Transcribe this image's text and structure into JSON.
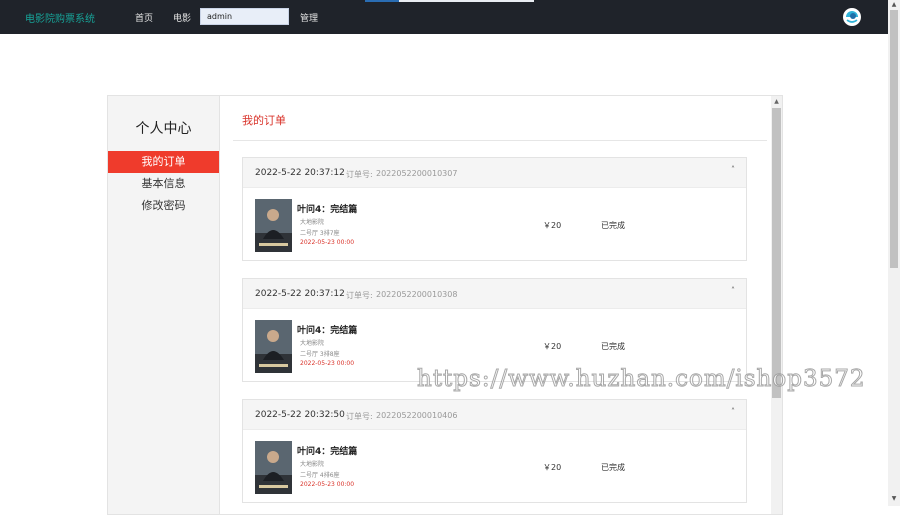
{
  "navbar": {
    "brand": "电影院购票系统",
    "links": [
      "首页",
      "电影"
    ],
    "search_value": "admin",
    "admin_link": "管理"
  },
  "sidebar": {
    "title": "个人中心",
    "items": [
      {
        "label": "我的订单",
        "active": true
      },
      {
        "label": "基本信息",
        "active": false
      },
      {
        "label": "修改密码",
        "active": false
      }
    ]
  },
  "content": {
    "title": "我的订单",
    "order_no_label": "订单号:",
    "orders": [
      {
        "time": "2022-5-22 20:37:12",
        "order_no": "2022052200010307",
        "movie": "叶问4：完结篇",
        "cinema": "大地影院",
        "hall_seat": "二号厅 3排7座",
        "showtime": "2022-05-23 00:00",
        "price": "￥20",
        "status": "已完成",
        "close": "˄"
      },
      {
        "time": "2022-5-22 20:37:12",
        "order_no": "2022052200010308",
        "movie": "叶问4：完结篇",
        "cinema": "大地影院",
        "hall_seat": "二号厅 3排8座",
        "showtime": "2022-05-23 00:00",
        "price": "￥20",
        "status": "已完成",
        "close": "˄"
      },
      {
        "time": "2022-5-22 20:32:50",
        "order_no": "2022052200010406",
        "movie": "叶问4：完结篇",
        "cinema": "大地影院",
        "hall_seat": "二号厅 4排6座",
        "showtime": "2022-05-23 00:00",
        "price": "￥20",
        "status": "已完成",
        "close": "˄"
      }
    ]
  },
  "watermark": "https://www.huzhan.com/ishop3572",
  "colors": {
    "navbar_bg": "#1f232a",
    "brand": "#17a398",
    "accent_red": "#ef3b2c",
    "showtime_red": "#d9332a"
  }
}
